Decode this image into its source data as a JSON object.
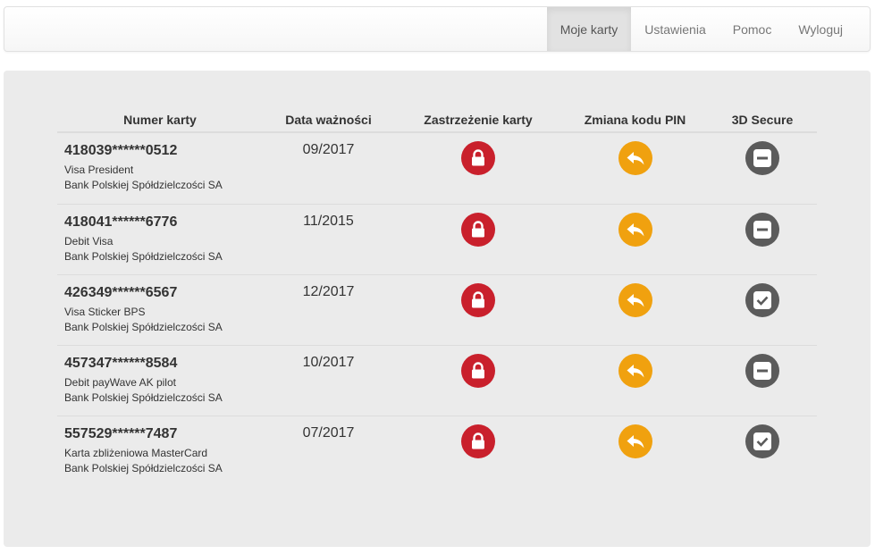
{
  "nav": {
    "items": [
      "Moje karty",
      "Ustawienia",
      "Pomoc",
      "Wyloguj"
    ],
    "active": "Moje karty"
  },
  "table": {
    "headers": [
      "Numer karty",
      "Data ważności",
      "Zastrzeżenie karty",
      "Zmiana kodu PIN",
      "3D Secure"
    ],
    "rows": [
      {
        "number": "418039******0512",
        "type": "Visa President",
        "bank": "Bank Polskiej Spółdzielczości SA",
        "expiry": "09/2017",
        "secure_icon": "minus-icon"
      },
      {
        "number": "418041******6776",
        "type": "Debit Visa",
        "bank": "Bank Polskiej Spółdzielczości SA",
        "expiry": "11/2015",
        "secure_icon": "minus-icon"
      },
      {
        "number": "426349******6567",
        "type": "Visa Sticker BPS",
        "bank": "Bank Polskiej Spółdzielczości SA",
        "expiry": "12/2017",
        "secure_icon": "check-icon"
      },
      {
        "number": "457347******8584",
        "type": "Debit payWave AK pilot",
        "bank": "Bank Polskiej Spółdzielczości SA",
        "expiry": "10/2017",
        "secure_icon": "minus-icon"
      },
      {
        "number": "557529******7487",
        "type": "Karta zbliżeniowa MasterCard",
        "bank": "Bank Polskiej Spółdzielczości SA",
        "expiry": "07/2017",
        "secure_icon": "check-icon"
      }
    ]
  },
  "icons": {
    "block": "lock-icon",
    "pin": "reply-arrow-icon"
  },
  "colors": {
    "block": "#c9202c",
    "pin": "#f0a10f",
    "secure": "#5b5b5b"
  }
}
